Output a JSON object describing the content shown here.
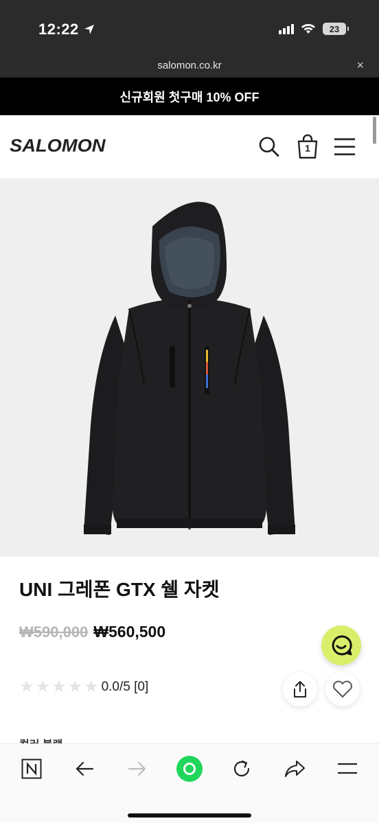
{
  "status_bar": {
    "time": "12:22",
    "battery": "23"
  },
  "browser": {
    "url": "salomon.co.kr",
    "close_glyph": "×"
  },
  "promo": {
    "text": "신규회원 첫구매 10% OFF"
  },
  "header": {
    "logo": "SALOMON",
    "cart_count": "1"
  },
  "product": {
    "title": "UNI 그레폰 GTX 쉘 자켓",
    "original_price": "₩590,000",
    "sale_price": "₩560,500",
    "rating_text": "0.0/5 [0]",
    "stars": 5
  },
  "section_peek": "컬러 블랙",
  "colors": {
    "accent": "#d8ef6a",
    "promo_bg": "#000000",
    "naver_green": "#1fd65b"
  },
  "icons": [
    "navigation-arrow-icon",
    "signal-icon",
    "wifi-icon",
    "battery-icon",
    "search-icon",
    "cart-icon",
    "menu-icon",
    "chat-icon",
    "share-icon",
    "heart-icon",
    "naver-n-icon",
    "back-icon",
    "forward-icon",
    "home-orb-icon",
    "reload-icon",
    "share-arrow-icon",
    "more-menu-icon"
  ]
}
